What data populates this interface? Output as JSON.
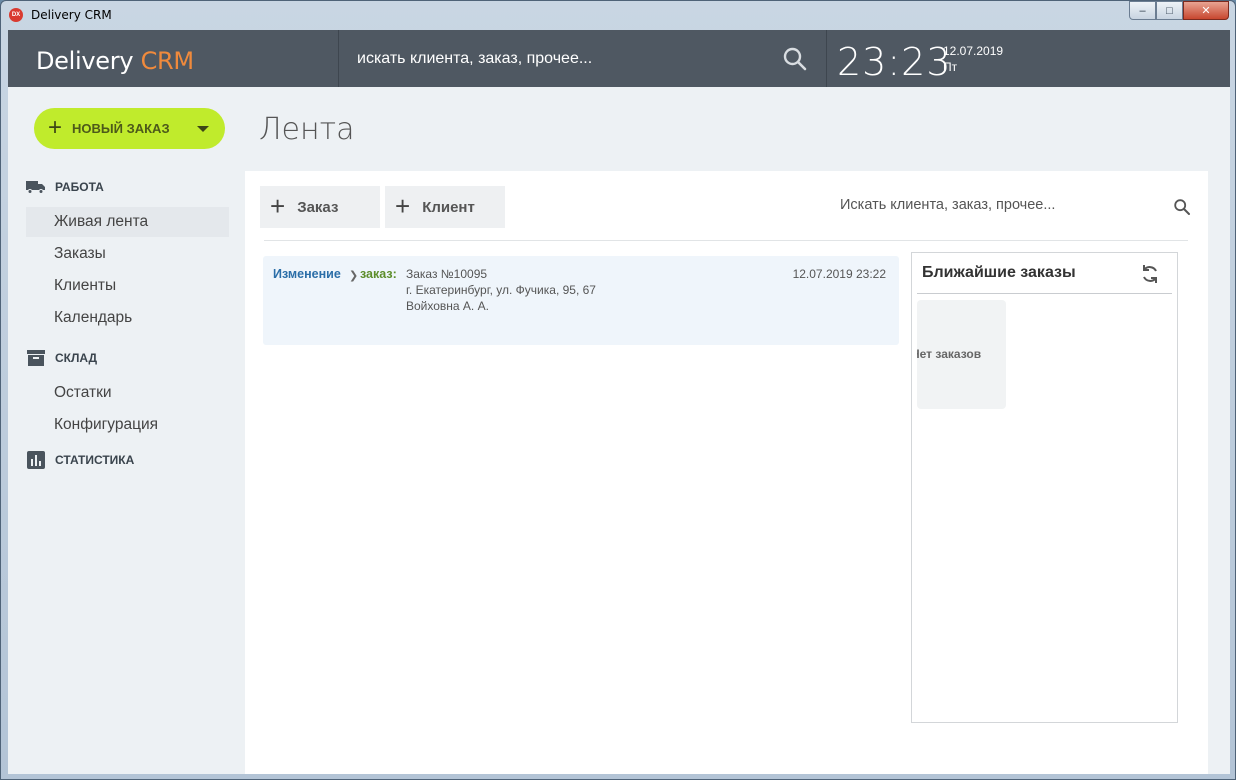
{
  "window": {
    "icon_text": "DX",
    "title": "Delivery CRM",
    "controls": {
      "minimize": "–",
      "maximize": "□",
      "close": "✕"
    }
  },
  "header": {
    "brand_main": "Delivery ",
    "brand_accent": "CRM",
    "search_placeholder": "искать клиента, заказ, прочее...",
    "search_icon": "search-icon",
    "time": "23:23",
    "date": "12.07.2019",
    "weekday": "Пт"
  },
  "sidebar": {
    "new_order_label": "НОВЫЙ ЗАКАЗ",
    "sections": [
      {
        "label": "РАБОТА",
        "icon": "truck-icon",
        "items": [
          "Живая лента",
          "Заказы",
          "Клиенты",
          "Календарь"
        ]
      },
      {
        "label": "СКЛАД",
        "icon": "box-icon",
        "items": [
          "Остатки",
          "Конфигурация"
        ]
      },
      {
        "label": "СТАТИСТИКА",
        "icon": "chart-icon",
        "items": []
      }
    ],
    "active_item": "Живая лента"
  },
  "main": {
    "page_title": "Лента",
    "toolbar": {
      "add_order_label": "Заказ",
      "add_client_label": "Клиент",
      "search_placeholder": "Искать клиента, заказ, прочее..."
    },
    "feed": [
      {
        "action": "Изменение",
        "entity": "заказ:",
        "order": "Заказ №10095",
        "address": "г. Екатеринбург, ул. Фучика, 95, 67",
        "person": "Войховна А. А.",
        "datetime": "12.07.2019 23:22"
      }
    ],
    "upcoming": {
      "title": "Ближайшие заказы",
      "empty_text": "Нет заказов"
    }
  },
  "colors": {
    "header_bg": "#4f5862",
    "brand_accent": "#f08a3c",
    "new_order_bg": "#c0eb2c",
    "feed_action": "#2b6ea8",
    "feed_entity": "#5c8d2a"
  }
}
